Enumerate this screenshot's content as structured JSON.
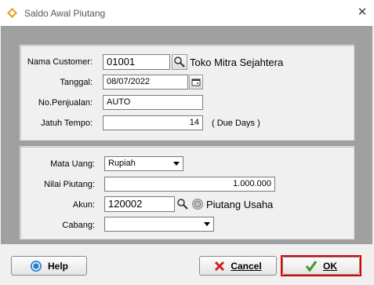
{
  "window": {
    "title": "Saldo Awal Piutang",
    "close_label": "✕"
  },
  "top": {
    "nama_customer_label": "Nama Customer:",
    "nama_customer_value": "01001",
    "customer_name": "Toko Mitra Sejahtera",
    "tanggal_label": "Tanggal:",
    "tanggal_value": "08/07/2022",
    "no_penjualan_label": "No.Penjualan:",
    "no_penjualan_value": "AUTO",
    "jatuh_tempo_label": "Jatuh Tempo:",
    "jatuh_tempo_value": "14",
    "due_days_label": "( Due Days )"
  },
  "bottom": {
    "mata_uang_label": "Mata Uang:",
    "mata_uang_value": "Rupiah",
    "nilai_piutang_label": "Nilai Piutang:",
    "nilai_piutang_value": "1.000.000",
    "akun_label": "Akun:",
    "akun_value": "120002",
    "akun_name": "Piutang Usaha",
    "cabang_label": "Cabang:",
    "cabang_value": ""
  },
  "buttons": {
    "help": "Help",
    "cancel": "Cancel",
    "ok": "OK"
  },
  "colors": {
    "highlight": "#e00000",
    "ok_icon": "#3a9a2a",
    "cancel_icon": "#d42020",
    "help_icon": "#2a7fd4",
    "app_icon": "#e8a020"
  }
}
